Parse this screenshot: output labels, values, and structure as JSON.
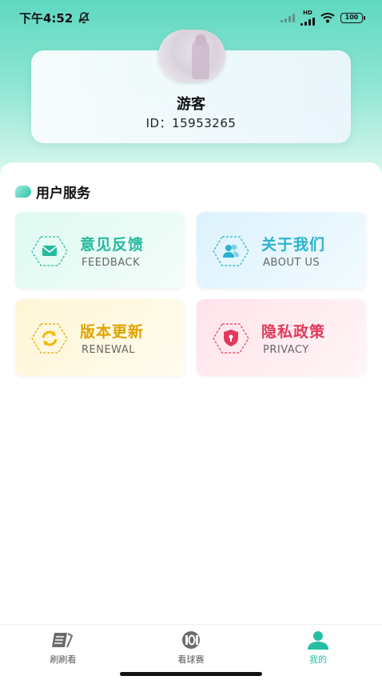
{
  "status_bar": {
    "time": "下午4:52",
    "network_label": "HD",
    "battery": "100"
  },
  "profile": {
    "nickname": "游客",
    "id_label": "ID：",
    "id_value": "15953265"
  },
  "user_services": {
    "title": "用户服务",
    "items": [
      {
        "title": "意见反馈",
        "subtitle": "FEEDBACK",
        "icon": "mail-icon",
        "color": "#27b99e"
      },
      {
        "title": "关于我们",
        "subtitle": "ABOUT US",
        "icon": "users-icon",
        "color": "#27b3cf"
      },
      {
        "title": "版本更新",
        "subtitle": "RENEWAL",
        "icon": "refresh-icon",
        "color": "#e0a400"
      },
      {
        "title": "隐私政策",
        "subtitle": "PRIVACY",
        "icon": "shield-icon",
        "color": "#e23a5c"
      }
    ]
  },
  "tab_bar": {
    "tabs": [
      {
        "label": "刷刷看",
        "icon": "notebook-icon"
      },
      {
        "label": "看球赛",
        "icon": "ball-icon"
      },
      {
        "label": "我的",
        "icon": "person-icon",
        "active": true
      }
    ]
  },
  "colors": {
    "accent": "#26bfa3"
  }
}
